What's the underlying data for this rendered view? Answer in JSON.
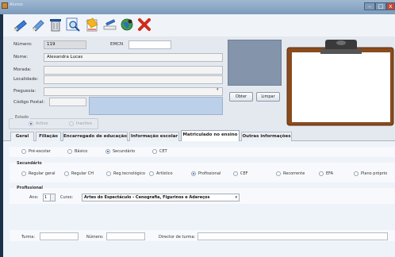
{
  "window": {
    "title": "Alunos"
  },
  "toolbar": {
    "buttons": [
      {
        "icon": "pencil-icon"
      },
      {
        "icon": "edit-pencil-icon"
      },
      {
        "icon": "trash-icon"
      },
      {
        "icon": "search-icon"
      },
      {
        "icon": "new-document-icon"
      },
      {
        "icon": "write-icon"
      },
      {
        "icon": "globe-icon"
      },
      {
        "icon": "delete-x-icon"
      }
    ]
  },
  "student": {
    "numero_label": "Número:",
    "numero_value": "119",
    "emcn_label": "EMCN",
    "emcn_value": "",
    "nome_label": "Nome:",
    "nome_value": "Alexandra Lucas",
    "morada_label": "Morada:",
    "morada_value": "",
    "localidade_label": "Localidade:",
    "localidade_value": "",
    "freguesia_label": "Freguesia:",
    "freguesia_value": "",
    "codigo_postal_label": "Código Postal:",
    "codigo_postal_value": ""
  },
  "photo": {
    "obter_label": "Obter",
    "limpar_label": "Limpar"
  },
  "estado": {
    "title": "Estado",
    "options": [
      {
        "label": "Activo",
        "selected": true
      },
      {
        "label": "Inactivo",
        "selected": false
      }
    ]
  },
  "tabs": [
    {
      "label": "Geral",
      "active": false
    },
    {
      "label": "Filiação",
      "active": false
    },
    {
      "label": "Encarregado de educação",
      "active": false
    },
    {
      "label": "Informação escolar",
      "active": false
    },
    {
      "label": "Matriculado no ensino",
      "active": true
    },
    {
      "label": "Outras informações",
      "active": false
    }
  ],
  "ensino": {
    "levels": [
      {
        "label": "Pré-escolar",
        "selected": false
      },
      {
        "label": "Básico",
        "selected": false
      },
      {
        "label": "Secundário",
        "selected": true
      },
      {
        "label": "CET",
        "selected": false
      }
    ]
  },
  "secundario": {
    "title": "Secundário",
    "options": [
      {
        "label": "Regular geral",
        "selected": false
      },
      {
        "label": "Regular CH",
        "selected": false
      },
      {
        "label": "Reg.tecnológico",
        "selected": false
      },
      {
        "label": "Artístico",
        "selected": false
      },
      {
        "label": "Profissional",
        "selected": true
      },
      {
        "label": "CEF",
        "selected": false
      },
      {
        "label": "Recorrente",
        "selected": false
      },
      {
        "label": "EFA",
        "selected": false
      },
      {
        "label": "Plano próprio",
        "selected": false
      }
    ]
  },
  "profissional": {
    "title": "Profissional",
    "ano_label": "Ano:",
    "ano_value": "1",
    "curso_label": "Curso:",
    "curso_value": "Artes do Espectáculo - Cenografia, Figurinos e Adereços"
  },
  "bottom": {
    "turma_label": "Turma:",
    "turma_value": "",
    "numero_label": "Número:",
    "numero_value": "",
    "director_label": "Director de turma:",
    "director_value": ""
  }
}
